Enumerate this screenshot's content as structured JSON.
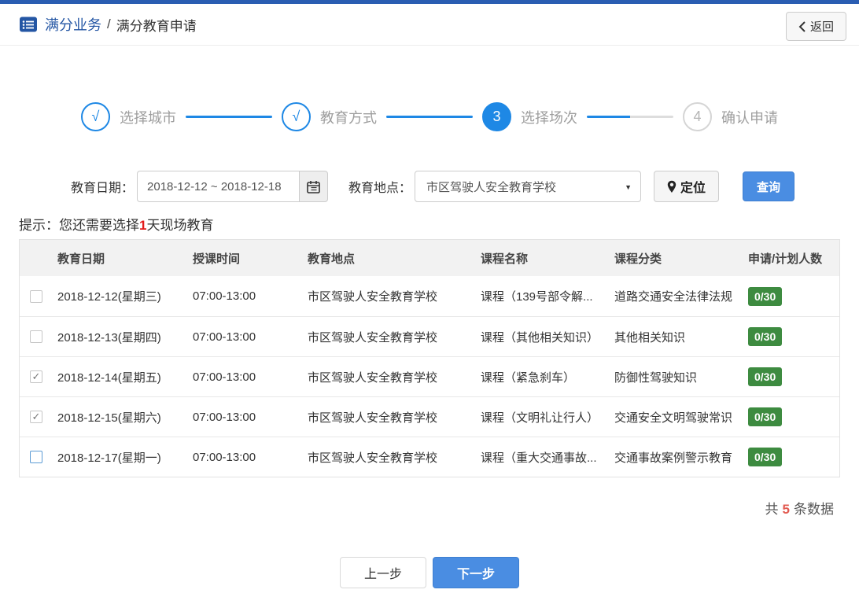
{
  "header": {
    "breadcrumb_primary": "满分业务",
    "breadcrumb_separator": "/",
    "breadcrumb_secondary": "满分教育申请",
    "back_button": "返回"
  },
  "steps": [
    {
      "num": "√",
      "label": "选择城市",
      "state": "done"
    },
    {
      "num": "√",
      "label": "教育方式",
      "state": "done"
    },
    {
      "num": "3",
      "label": "选择场次",
      "state": "active"
    },
    {
      "num": "4",
      "label": "确认申请",
      "state": "pending"
    }
  ],
  "filters": {
    "date_label": "教育日期：",
    "date_value": "2018-12-12 ~ 2018-12-18",
    "location_label": "教育地点：",
    "location_value": "市区驾驶人安全教育学校",
    "locate_button": "定位",
    "search_button": "查询",
    "caret": "▼"
  },
  "hint": {
    "prefix": "提示：您还需要选择",
    "highlight": "1",
    "suffix": "天现场教育"
  },
  "table": {
    "columns": [
      "教育日期",
      "授课时间",
      "教育地点",
      "课程名称",
      "课程分类",
      "申请/计划人数"
    ],
    "check_glyph": "✓",
    "rows": [
      {
        "checkbox": "unchecked",
        "date": "2018-12-12(星期三)",
        "time": "07:00-13:00",
        "location": "市区驾驶人安全教育学校",
        "course": "课程（139号部令解...",
        "category": "道路交通安全法律法规",
        "count": "0/30"
      },
      {
        "checkbox": "unchecked",
        "date": "2018-12-13(星期四)",
        "time": "07:00-13:00",
        "location": "市区驾驶人安全教育学校",
        "course": "课程（其他相关知识）",
        "category": "其他相关知识",
        "count": "0/30"
      },
      {
        "checkbox": "checked",
        "date": "2018-12-14(星期五)",
        "time": "07:00-13:00",
        "location": "市区驾驶人安全教育学校",
        "course": "课程（紧急刹车）",
        "category": "防御性驾驶知识",
        "count": "0/30"
      },
      {
        "checkbox": "checked",
        "date": "2018-12-15(星期六)",
        "time": "07:00-13:00",
        "location": "市区驾驶人安全教育学校",
        "course": "课程（文明礼让行人）",
        "category": "交通安全文明驾驶常识",
        "count": "0/30"
      },
      {
        "checkbox": "focus",
        "date": "2018-12-17(星期一)",
        "time": "07:00-13:00",
        "location": "市区驾驶人安全教育学校",
        "course": "课程（重大交通事故...",
        "category": "交通事故案例警示教育",
        "count": "0/30"
      }
    ]
  },
  "footer": {
    "total_prefix": "共",
    "total_count": "5",
    "total_suffix": "条数据"
  },
  "actions": {
    "prev": "上一步",
    "next": "下一步"
  },
  "colors": {
    "top_bar": "#2a5db2",
    "brand_blue": "#2456a4",
    "accent_blue": "#1e88e5",
    "button_blue": "#4a8de2",
    "badge_green": "#3d8b40",
    "alert_red": "#e21a1a",
    "count_red": "#e25a50"
  }
}
